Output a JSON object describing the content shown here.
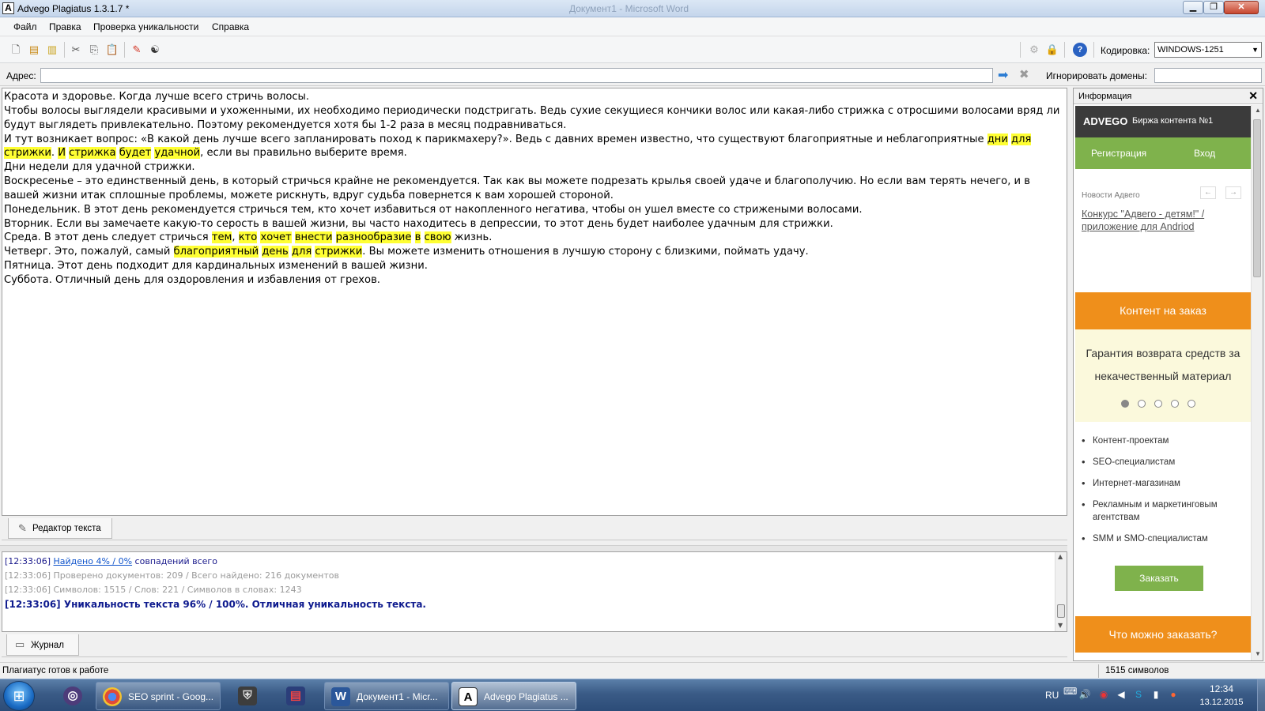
{
  "window": {
    "title": "Advego Plagiatus 1.3.1.7 *",
    "ghost_title": "Документ1 - Microsoft Word",
    "app_icon": "A"
  },
  "menu": [
    "Файл",
    "Правка",
    "Проверка уникальности",
    "Справка"
  ],
  "toolbar": {
    "encoding_label": "Кодировка:",
    "encoding_value": "WINDOWS-1251"
  },
  "address": {
    "label": "Адрес:",
    "value": "",
    "ignore_label": "Игнорировать домены:",
    "ignore_value": ""
  },
  "editor": {
    "paragraphs": [
      [
        {
          "t": "Красота и здоровье. Когда лучше всего стричь волосы."
        }
      ],
      [
        {
          "t": "Чтобы волосы выглядели красивыми и ухоженными, их необходимо периодически подстригать. Ведь сухие секущиеся кончики волос или какая-либо  стрижка с отросшими волосами вряд ли будут выглядеть привлекательно. Поэтому рекомендуется хотя бы 1-2 раза в месяц подравниваться."
        }
      ],
      [
        {
          "t": "И тут возникает вопрос: «В какой день лучше всего запланировать поход к парикмахеру?». Ведь с давних времен известно, что существуют благоприятные и неблагоприятные "
        },
        {
          "t": "дни",
          "h": true
        },
        {
          "t": " "
        },
        {
          "t": "для",
          "h": true
        },
        {
          "t": " "
        },
        {
          "t": "стрижки",
          "h": true
        },
        {
          "t": ". "
        },
        {
          "t": "И",
          "h": true
        },
        {
          "t": " "
        },
        {
          "t": "стрижка",
          "h": true
        },
        {
          "t": " "
        },
        {
          "t": "будет",
          "h": true
        },
        {
          "t": " "
        },
        {
          "t": "удачной",
          "h": true
        },
        {
          "t": ", если вы правильно выберите время."
        }
      ],
      [
        {
          "t": "Дни недели для удачной стрижки."
        }
      ],
      [
        {
          "t": "Воскресенье – это единственный день, в который стричься крайне не рекомендуется. Так как вы можете подрезать крылья своей удаче и благополучию. Но если вам терять нечего, и в вашей жизни итак сплошные проблемы, можете рискнуть, вдруг судьба повернется к вам хорошей стороной."
        }
      ],
      [
        {
          "t": "Понедельник. В этот день рекомендуется стричься тем, кто хочет избавиться от накопленного негатива, чтобы он ушел вместе со стрижеными волосами."
        }
      ],
      [
        {
          "t": "Вторник. Если вы замечаете какую-то серость в вашей жизни, вы часто находитесь в депрессии, то этот день будет наиболее удачным для стрижки."
        }
      ],
      [
        {
          "t": "Среда. В этот день следует стричься "
        },
        {
          "t": "тем",
          "h": true
        },
        {
          "t": ", "
        },
        {
          "t": "кто",
          "h": true
        },
        {
          "t": " "
        },
        {
          "t": "хочет",
          "h": true
        },
        {
          "t": " "
        },
        {
          "t": "внести",
          "h": true
        },
        {
          "t": " "
        },
        {
          "t": "разнообразие",
          "h": true
        },
        {
          "t": " "
        },
        {
          "t": "в",
          "h": true
        },
        {
          "t": " "
        },
        {
          "t": "свою",
          "h": true
        },
        {
          "t": " жизнь."
        }
      ],
      [
        {
          "t": "Четверг. Это, пожалуй, самый "
        },
        {
          "t": "благоприятный",
          "h": true
        },
        {
          "t": " "
        },
        {
          "t": "день",
          "h": true
        },
        {
          "t": " "
        },
        {
          "t": "для",
          "h": true
        },
        {
          "t": " "
        },
        {
          "t": "стрижки",
          "h": true
        },
        {
          "t": ". Вы можете изменить отношения в лучшую сторону с близкими, поймать удачу."
        }
      ],
      [
        {
          "t": "Пятница. Этот день  подходит для кардинальных изменений в вашей жизни."
        }
      ],
      [
        {
          "t": "Суббота. Отличный день для оздоровления и избавления от грехов."
        }
      ]
    ],
    "tab_label": "Редактор текста"
  },
  "log": {
    "line1_time": "[12:33:06]",
    "line1_link": "Найдено 4% / 0%",
    "line1_rest": " совпадений всего",
    "line2": "[12:33:06] Проверено документов: 209  / Всего найдено: 216 документов",
    "line3": "[12:33:06] Символов: 1515 / Слов: 221 / Символов в словах: 1243",
    "line4": "[12:33:06] Уникальность текста 96% / 100%. Отличная уникальность текста.",
    "tab_label": "Журнал"
  },
  "status": {
    "text": "Плагиатус готов к работе",
    "count": "1515 символов"
  },
  "info": {
    "title": "Информация",
    "brand": "ADVEGO",
    "tagline": "Биржа контента №1",
    "register": "Регистрация",
    "login": "Вход",
    "news_label": "Новости Адвего",
    "news_link": "Конкурс \"Адвего - детям!\" / приложение для Andriod",
    "order_banner": "Контент на заказ",
    "guarantee": "Гарантия возврата средств за некачественный материал",
    "list": [
      "Контент-проектам",
      "SEO-специалистам",
      "Интернет-магазинам",
      "Рекламным и маркетинговым агентствам",
      "SMM и SMO-специалистам"
    ],
    "order_button": "Заказать",
    "what_banner": "Что можно заказать?"
  },
  "taskbar": {
    "tasks": [
      {
        "label": "SEO sprint - Goog...",
        "icon": "chrome-icon"
      },
      {
        "label": "Документ1 - Micr...",
        "icon": "word-icon"
      },
      {
        "label": "Advego Plagiatus ...",
        "icon": "advego-icon"
      }
    ],
    "lang": "RU",
    "time": "12:34",
    "date": "13.12.2015"
  }
}
